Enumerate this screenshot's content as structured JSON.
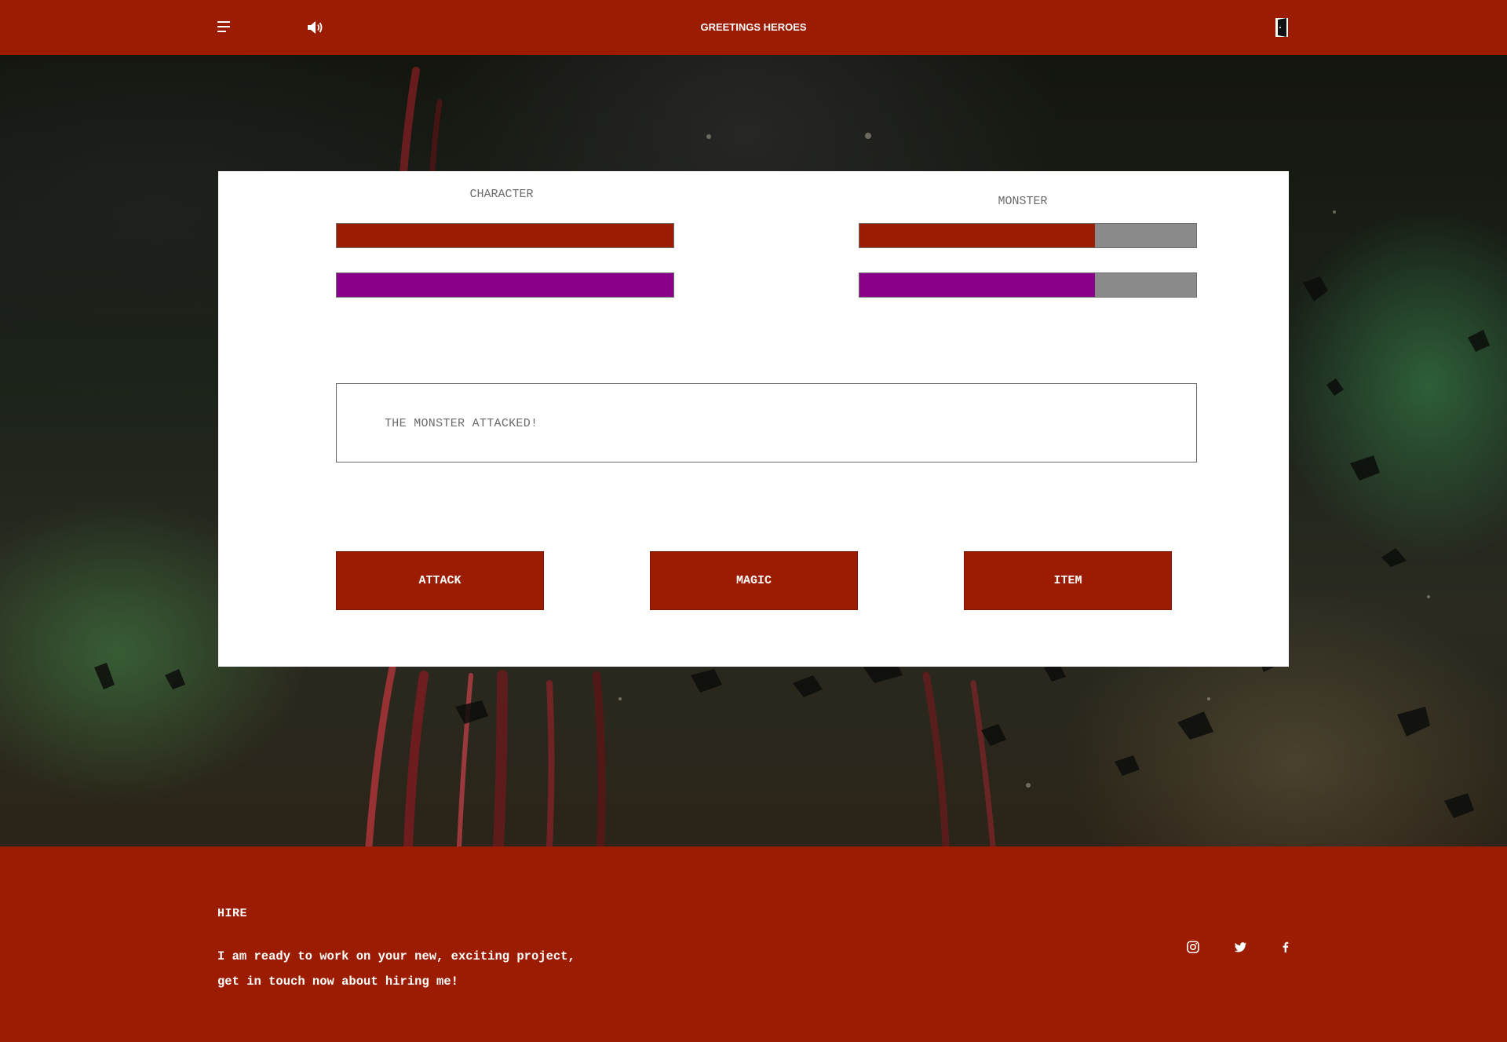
{
  "header": {
    "title": "GREETINGS HEROES",
    "menu_icon": "hamburger-menu-icon",
    "sound_icon": "speaker-icon",
    "exit_icon": "door-exit-icon"
  },
  "battle": {
    "character": {
      "label": "CHARACTER",
      "health": 1.0,
      "magic": 1.0
    },
    "monster": {
      "label": "MONSTER",
      "health": 0.7,
      "magic": 0.7
    },
    "log_message": "THE MONSTER ATTACKED!",
    "actions": [
      "ATTACK",
      "MAGIC",
      "ITEM"
    ]
  },
  "footer": {
    "heading": "HIRE",
    "text_line1": "I am ready to work on your new, exciting project,",
    "text_line2": "get in touch now about hiring me!",
    "social": [
      "instagram-icon",
      "twitter-icon",
      "facebook-icon"
    ]
  },
  "colors": {
    "brand_red": "#9b1c00",
    "health": "#9b1c00",
    "magic": "#8b008b",
    "empty_bar": "#8a8a8a"
  }
}
